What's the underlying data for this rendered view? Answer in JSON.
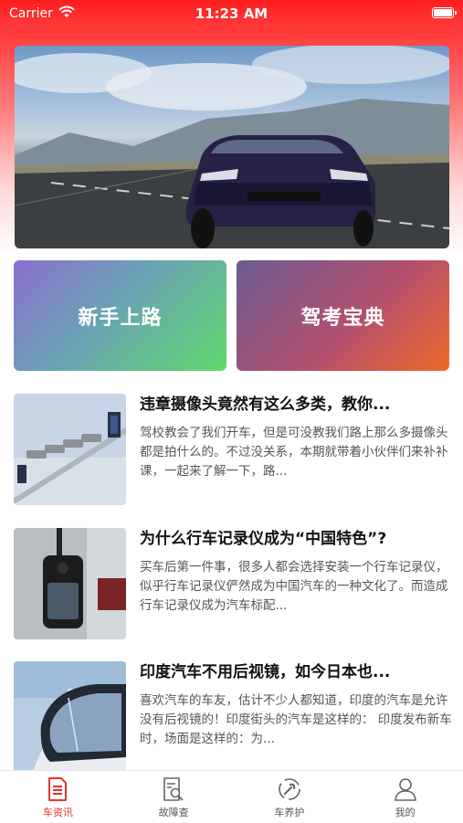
{
  "status_bar": {
    "carrier": "Carrier",
    "time": "11:23 AM"
  },
  "banner": {
    "icon": "car-photo"
  },
  "quick_cards": [
    {
      "label": "新手上路"
    },
    {
      "label": "驾考宝典"
    }
  ],
  "articles": [
    {
      "title": "违章摄像头竟然有这么多类，教你...",
      "desc": "驾校教会了我们开车，但是可没教我们路上那么多摄像头都是拍什么的。不过没关系，本期就带着小伙伴们来补补课，一起来了解一下，路..."
    },
    {
      "title": "为什么行车记录仪成为“中国特色”?",
      "desc": "买车后第一件事，很多人都会选择安装一个行车记录仪，似乎行车记录仪俨然成为中国汽车的一种文化了。而造成行车记录仪成为汽车标配..."
    },
    {
      "title": "印度汽车不用后视镜，如今日本也...",
      "desc": "喜欢汽车的车友，估计不少人都知道，印度的汽车是允许没有后视镜的！印度街头的汽车是这样的：  印度发布新车时，场面是这样的：为..."
    }
  ],
  "tabs": [
    {
      "label": "车资讯",
      "icon": "document-icon",
      "active": true
    },
    {
      "label": "故障查",
      "icon": "search-document-icon",
      "active": false
    },
    {
      "label": "车养护",
      "icon": "wrench-icon",
      "active": false
    },
    {
      "label": "我的",
      "icon": "user-icon",
      "active": false
    }
  ],
  "colors": {
    "accent": "#e8322b",
    "header": "#ff1c1c"
  }
}
